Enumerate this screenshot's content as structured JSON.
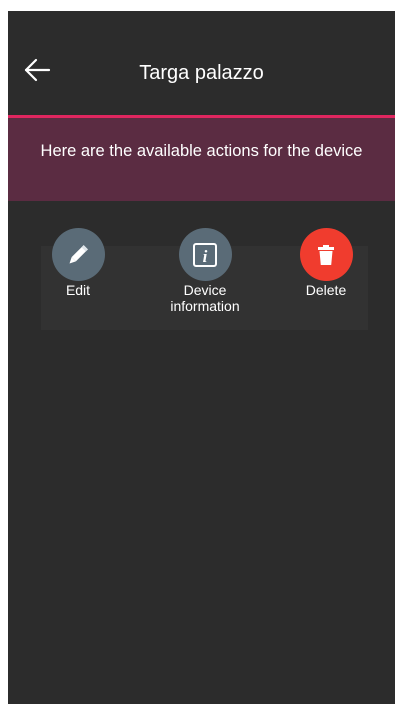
{
  "header": {
    "title": "Targa palazzo",
    "back_icon": "arrow-left-icon"
  },
  "banner": {
    "text": "Here are the available actions for the device",
    "accent_color": "#e0265f",
    "background_color": "#5b2c42"
  },
  "actions": [
    {
      "label": "Edit",
      "icon": "pencil-icon",
      "color": "#5a6b77"
    },
    {
      "label": "Device\ninformation",
      "icon": "info-icon",
      "color": "#5a6b77"
    },
    {
      "label": "Delete",
      "icon": "trash-icon",
      "color": "#f03c2e"
    }
  ]
}
